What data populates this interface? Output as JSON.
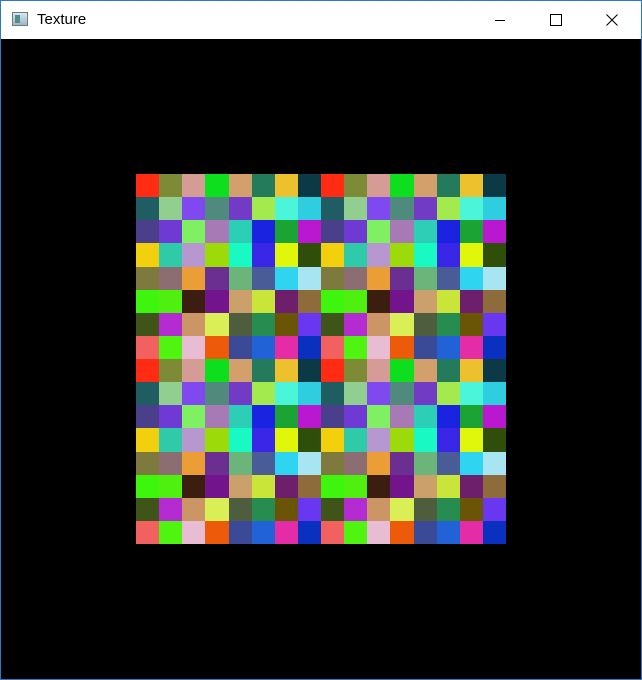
{
  "window": {
    "title": "Texture",
    "icon": "application-window-icon",
    "controls": {
      "minimize": "minimize-icon",
      "maximize": "maximize-icon",
      "close": "close-icon"
    },
    "background_color": "#000000"
  },
  "texture": {
    "palette": [
      [
        "#ff2b12",
        "#7e8b36",
        "#d59b95",
        "#0ddf1f",
        "#d3a06c",
        "#237b5c",
        "#edc12e",
        "#0b3a46"
      ],
      [
        "#1f5d62",
        "#91cf91",
        "#8049f0",
        "#508a7c",
        "#713bc6",
        "#a2ea4e",
        "#4af5d9",
        "#2fcde0"
      ],
      [
        "#4a3f8b",
        "#6f39d4",
        "#7ef062",
        "#a77ab6",
        "#2ccfb6",
        "#1a24e0",
        "#1ba433",
        "#ba17d0"
      ],
      [
        "#f2d00d",
        "#2fcaa8",
        "#b797cf",
        "#9dda0a",
        "#19f9c4",
        "#3a26e6",
        "#e0f70c",
        "#2f4e09"
      ],
      [
        "#7e7a3d",
        "#8c6d71",
        "#eb9e36",
        "#6b2e91",
        "#6bb47a",
        "#495c97",
        "#2fd4f0",
        "#a7e5f2"
      ],
      [
        "#3df50d",
        "#4ff010",
        "#3c1e10",
        "#72148b",
        "#cca06b",
        "#cae53a",
        "#6e1f6c",
        "#8e6b3a"
      ],
      [
        "#3e5418",
        "#b32bd1",
        "#cc9566",
        "#d9ef55",
        "#4d5d3d",
        "#268c4f",
        "#6a5507",
        "#6937ef"
      ],
      [
        "#f0615f",
        "#4ff510",
        "#e8bcd3",
        "#ec5a0a",
        "#3a4a97",
        "#2163d7",
        "#e32ca6",
        "#0a30c0"
      ]
    ]
  }
}
